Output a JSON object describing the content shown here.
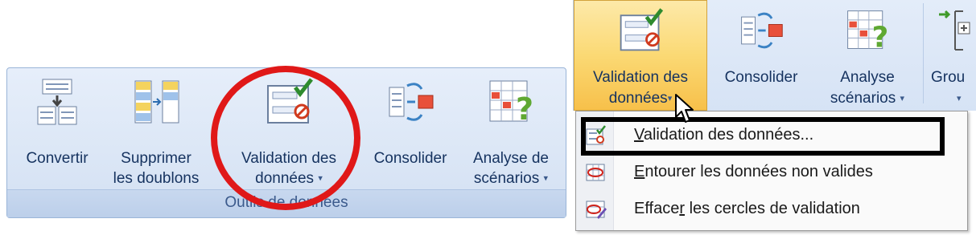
{
  "left_ribbon": {
    "buttons": [
      {
        "line1": "Convertir",
        "line2": "",
        "icon": "text-to-columns-icon"
      },
      {
        "line1": "Supprimer",
        "line2": "les doublons",
        "icon": "remove-duplicates-icon"
      },
      {
        "line1": "Validation des",
        "line2": "données",
        "icon": "data-validation-icon",
        "dropdown": true
      },
      {
        "line1": "Consolider",
        "line2": "",
        "icon": "consolidate-icon"
      },
      {
        "line1": "Analyse de",
        "line2": "scénarios",
        "icon": "what-if-analysis-icon",
        "dropdown": true
      }
    ],
    "group_label": "Outils de données"
  },
  "right_ribbon": {
    "validation": {
      "line1": "Validation des",
      "line2": "données",
      "icon": "data-validation-icon"
    },
    "consolidate": {
      "line1": "Consolider",
      "icon": "consolidate-icon"
    },
    "analysis": {
      "line1": "Analyse",
      "line2": "scénarios",
      "icon": "what-if-analysis-icon"
    },
    "group_partial": {
      "line1": "Grou",
      "icon": "group-icon"
    }
  },
  "dropdown_glyph": "▾",
  "menu": {
    "items": [
      {
        "before": "",
        "hotkey": "V",
        "after": "alidation des données...",
        "icon": "data-validation-icon"
      },
      {
        "before": "",
        "hotkey": "E",
        "after": "ntourer les données non valides",
        "icon": "circle-invalid-data-icon"
      },
      {
        "before": "Efface",
        "hotkey": "r",
        "after": " les cercles de validation",
        "icon": "clear-circles-icon"
      }
    ]
  },
  "colors": {
    "annotation_circle": "#e01818",
    "annotation_box": "#000000",
    "ribbon_text": "#15325f",
    "highlight": "#fbd974"
  }
}
